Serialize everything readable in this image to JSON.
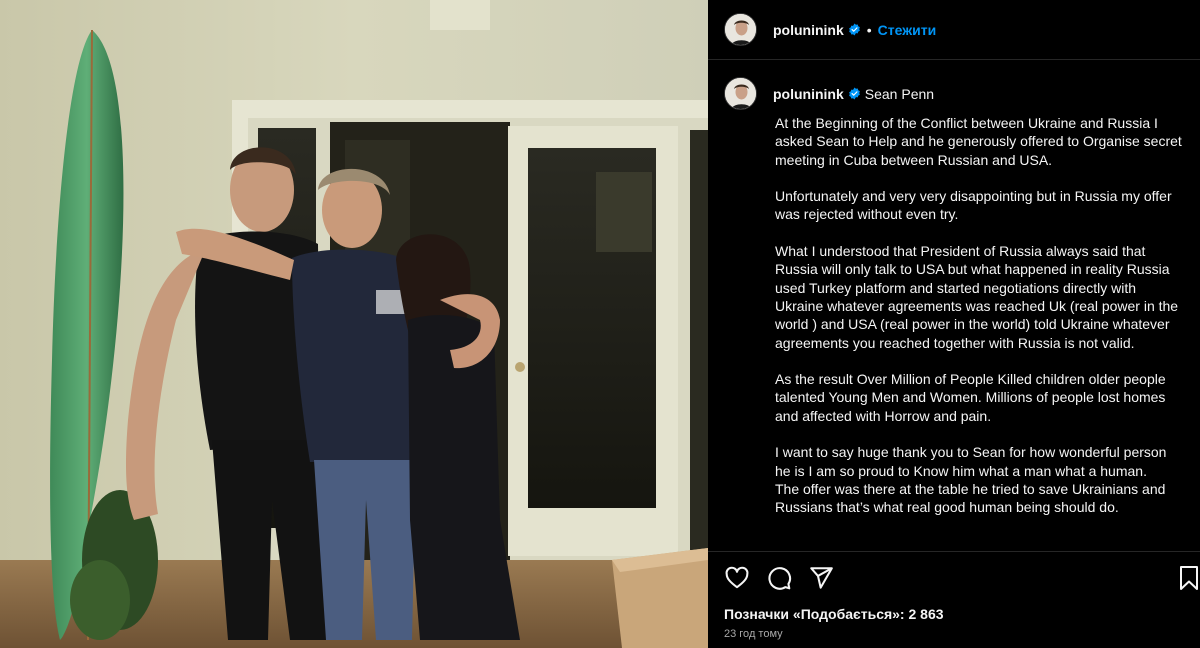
{
  "post": {
    "username": "poluninink",
    "follow_label": "Стежити",
    "dot": "•",
    "tagged_user": "Sean Penn",
    "caption": [
      "At the Beginning of the Conflict between Ukraine and Russia I asked Sean to Help and he generously offered to Organise secret meeting in Cuba between Russian and USA.",
      "Unfortunately and very very disappointing but in Russia my offer was rejected without even try.",
      "What I understood that President of Russia always said that Russia will only talk to USA but what happened in reality Russia used Turkey platform and started negotiations directly with Ukraine whatever agreements was reached Uk (real power in the world ) and USA (real power in the world) told Ukraine whatever agreements you reached together with Russia is not valid.",
      "As the result Over Million of People Killed children older people talented Young Men and Women. Millions of people lost homes and affected with Horrow and pain.",
      "I want to say huge thank you to Sean for how wonderful person he is I am so proud to Know him what a man what a human.",
      "The offer was there at the table he tried to save Ukrainians and Russians that’s what real good human being should do."
    ],
    "likes_text": "Позначки «Подобається»: 2 863",
    "timestamp": "23 год тому"
  },
  "icons": {
    "verified": "verified-badge-icon",
    "like": "heart-icon",
    "comment": "comment-icon",
    "share": "send-icon",
    "save": "bookmark-icon"
  },
  "colors": {
    "accent": "#0095f6",
    "background": "#000000",
    "text": "#f5f5f5",
    "muted": "#a8a8a8"
  }
}
